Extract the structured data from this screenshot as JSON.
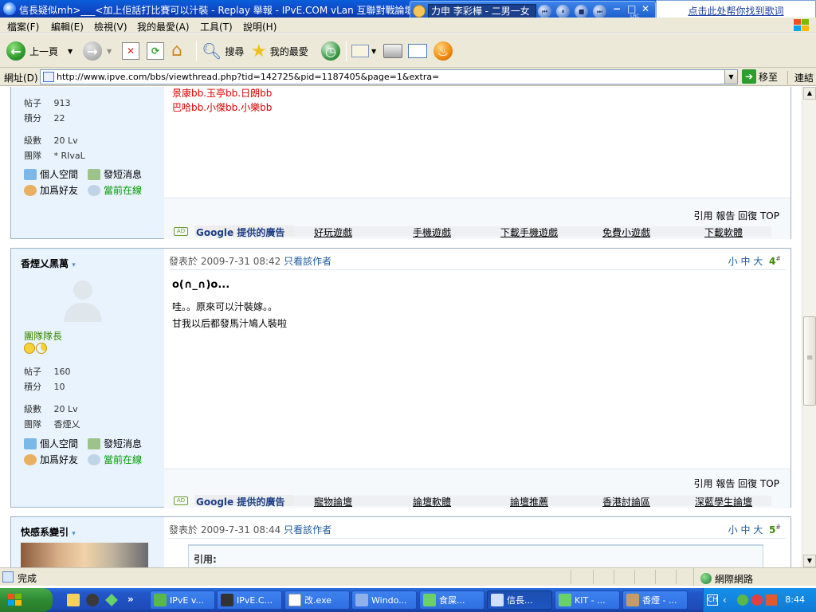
{
  "window": {
    "title": "信長疑似mh>___<加上佢話打比賽可以汁裝 - Replay 舉報 - IPvE.COM vLan 互聯對戰論壇 - Powe"
  },
  "lyrics_player": {
    "song": "力申 李彩樺 - 二男一女",
    "label": "LRC",
    "find_lyrics": "点击此处帮你找到歌词"
  },
  "menu": [
    "檔案(F)",
    "編輯(E)",
    "檢視(V)",
    "我的最愛(A)",
    "工具(T)",
    "說明(H)"
  ],
  "toolbar": {
    "back": "上一頁",
    "search": "搜尋",
    "favorites": "我的最愛"
  },
  "address": {
    "label": "網址(D)",
    "url": "http://www.ipve.com/bbs/viewthread.php?tid=142725&pid=1187405&page=1&extra=",
    "go": "移至",
    "links": "連結"
  },
  "post1": {
    "posts_label": "帖子",
    "posts": "913",
    "points_label": "積分",
    "points": "22",
    "level_label": "級數",
    "level": "20 Lv",
    "team_label": "團隊",
    "team": "* RIvaL",
    "space": "個人空間",
    "message": "發短消息",
    "add_friend": "加爲好友",
    "online": "當前在線",
    "sig_line1": "景康bb.玉亭bb.日朗bb",
    "sig_line2": "巴哈bb.小傑bb.小樂bb",
    "footer_actions": "引用 報告 回復 TOP",
    "ad_header": "Google 提供的廣告",
    "ads": [
      "好玩遊戲",
      "手機遊戲",
      "下載手機遊戲",
      "免費小遊戲",
      "下載軟體"
    ]
  },
  "post2": {
    "username": "香煙乂黑萬",
    "rank": "團隊隊長",
    "posts_label": "帖子",
    "posts": "160",
    "points_label": "積分",
    "points": "10",
    "level_label": "級數",
    "level": "20 Lv",
    "team_label": "團隊",
    "team": "香煙乂",
    "space": "個人空間",
    "message": "發短消息",
    "add_friend": "加爲好友",
    "online": "當前在線",
    "meta": "發表於 2009-7-31 08:42",
    "only_author": "只看該作者",
    "font_sizes": "小 中 大",
    "floor": "4",
    "floor_mark": "#",
    "subject": "ο(∩_∩)ο...",
    "body_line1": "哇。。原來可以汁裝嫁。。",
    "body_line2": "甘我以后都發馬汁鳩人裝啦",
    "footer_actions": "引用 報告 回復 TOP",
    "ad_header": "Google 提供的廣告",
    "ads": [
      "寵物論壇",
      "論壇軟體",
      "論壇推薦",
      "香港討論區",
      "深藍學生論壇"
    ]
  },
  "post3": {
    "username": "快感系變引",
    "meta": "發表於 2009-7-31 08:44",
    "only_author": "只看該作者",
    "font_sizes": "小 中 大",
    "floor": "5",
    "floor_mark": "#",
    "quote_label": "引用:"
  },
  "status": {
    "text": "完成",
    "zone": "網際網路"
  },
  "taskbar": {
    "buttons": [
      "IPvE v...",
      "IPvE.C...",
      "改.exe",
      "Windo...",
      "食屎...",
      "信長...",
      "KIT - ...",
      "香煙 - ..."
    ],
    "clock": "8:44"
  }
}
